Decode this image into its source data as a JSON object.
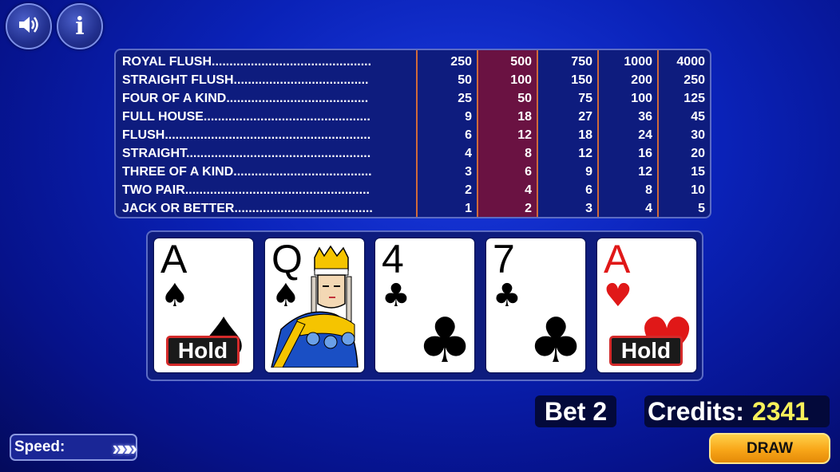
{
  "controls": {
    "sound_icon": "speaker-icon",
    "info_label": "i"
  },
  "paytable": {
    "hands": [
      "ROYAL FLUSH.............................................",
      "STRAIGHT FLUSH......................................",
      "FOUR OF A KIND........................................",
      "FULL HOUSE...............................................",
      "FLUSH..........................................................",
      "STRAIGHT....................................................",
      "THREE OF A KIND.......................................",
      "TWO PAIR....................................................",
      "JACK OR BETTER.......................................",
      "",
      ""
    ],
    "columns": [
      [
        "250",
        "50",
        "25",
        "9",
        "6",
        "4",
        "3",
        "2",
        "1"
      ],
      [
        "500",
        "100",
        "50",
        "18",
        "12",
        "8",
        "6",
        "4",
        "2"
      ],
      [
        "750",
        "150",
        "75",
        "27",
        "18",
        "12",
        "9",
        "6",
        "3"
      ],
      [
        "1000",
        "200",
        "100",
        "36",
        "24",
        "16",
        "12",
        "8",
        "4"
      ],
      [
        "4000",
        "250",
        "125",
        "45",
        "30",
        "20",
        "15",
        "10",
        "5"
      ]
    ],
    "active_column": 1
  },
  "cards": [
    {
      "rank": "A",
      "suit": "♠",
      "color": "#000000",
      "held": true,
      "face": false
    },
    {
      "rank": "Q",
      "suit": "♠",
      "color": "#000000",
      "held": false,
      "face": true
    },
    {
      "rank": "4",
      "suit": "♣",
      "color": "#000000",
      "held": false,
      "face": false
    },
    {
      "rank": "7",
      "suit": "♣",
      "color": "#000000",
      "held": false,
      "face": false
    },
    {
      "rank": "A",
      "suit": "♥",
      "color": "#e01818",
      "held": true,
      "face": false
    }
  ],
  "hold_label": "Hold",
  "bet": {
    "label": "Bet 2"
  },
  "credits": {
    "label": "Credits:",
    "value": "2341"
  },
  "speed": {
    "label": "Speed:",
    "arrows": "»»»"
  },
  "draw_label": "DRAW"
}
